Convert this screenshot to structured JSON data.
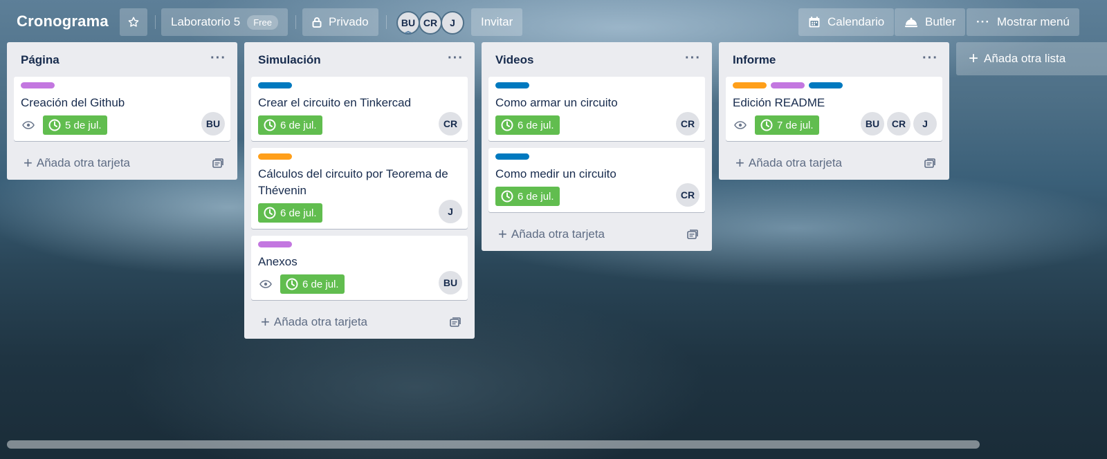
{
  "header": {
    "title": "Cronograma",
    "team": "Laboratorio 5",
    "team_badge": "Free",
    "visibility": "Privado",
    "members": [
      "BU",
      "CR",
      "J"
    ],
    "invite": "Invitar",
    "calendar": "Calendario",
    "butler": "Butler",
    "show_menu": "Mostrar menú"
  },
  "label_colors": {
    "purple": "#c377e0",
    "blue": "#0079bf",
    "orange": "#ff9f1a"
  },
  "add_card_label": "Añada otra tarjeta",
  "add_list_label": "Añada otra lista",
  "lists": [
    {
      "title": "Página",
      "cards": [
        {
          "title": "Creación del Github",
          "due": "5 de jul.",
          "labels": [
            "purple"
          ],
          "watching": true,
          "members": [
            "BU"
          ]
        }
      ]
    },
    {
      "title": "Simulación",
      "cards": [
        {
          "title": "Crear el circuito en Tinkercad",
          "due": "6 de jul.",
          "labels": [
            "blue"
          ],
          "watching": false,
          "members": [
            "CR"
          ]
        },
        {
          "title": "Cálculos del circuito por Teorema de Thévenin",
          "due": "6 de jul.",
          "labels": [
            "orange"
          ],
          "watching": false,
          "members": [
            "J"
          ]
        },
        {
          "title": "Anexos",
          "due": "6 de jul.",
          "labels": [
            "purple"
          ],
          "watching": true,
          "members": [
            "BU"
          ]
        }
      ]
    },
    {
      "title": "Videos",
      "cards": [
        {
          "title": "Como armar un circuito",
          "due": "6 de jul.",
          "labels": [
            "blue"
          ],
          "watching": false,
          "members": [
            "CR"
          ]
        },
        {
          "title": "Como medir un circuito",
          "due": "6 de jul.",
          "labels": [
            "blue"
          ],
          "watching": false,
          "members": [
            "CR"
          ]
        }
      ]
    },
    {
      "title": "Informe",
      "cards": [
        {
          "title": "Edición README",
          "due": "7 de jul.",
          "labels": [
            "orange",
            "purple",
            "blue"
          ],
          "watching": true,
          "members": [
            "BU",
            "CR",
            "J"
          ]
        }
      ]
    }
  ]
}
